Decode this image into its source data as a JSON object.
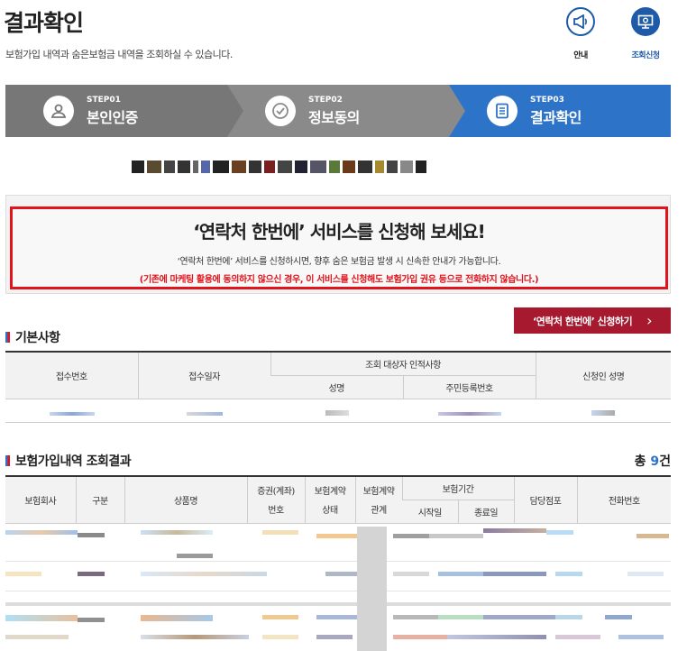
{
  "header": {
    "title": "결과확인",
    "description": "보험가입 내역과 숨은보험금 내역을 조회하실 수 있습니다.",
    "info_label": "안내",
    "apply_label": "조회신청"
  },
  "steps": [
    {
      "num": "STEP01",
      "name": "본인인증"
    },
    {
      "num": "STEP02",
      "name": "정보동의"
    },
    {
      "num": "STEP03",
      "name": "결과확인"
    }
  ],
  "banner": {
    "title": "‘연락처 한번에’ 서비스를 신청해 보세요!",
    "subtitle": "‘연락처 한번에’ 서비스를 신청하시면, 향후 숨은 보험금 발생 시 신속한 안내가 가능합니다.",
    "warning": "(기존에 마케팅 활용에 동의하지 않으신 경우, 이 서비스를 신청해도 보험가입 권유 등으로 전화하지 않습니다.)"
  },
  "apply_button": {
    "label": "‘연락처 한번에’ 신청하기",
    "arrow": "›"
  },
  "basic_section": {
    "title": "기본사항",
    "headers": {
      "receipt_no": "접수번호",
      "receipt_date": "접수일자",
      "target_group": "조회 대상자 인적사항",
      "name": "성명",
      "resident_no": "주민등록번호",
      "applicant": "신청인 성명"
    }
  },
  "result_section": {
    "title": "보험가입내역 조회결과",
    "total_prefix": "총 ",
    "total_count": "9",
    "total_suffix": "건",
    "headers": {
      "company": "보험회사",
      "category": "구분",
      "product": "상품명",
      "policy_no_1": "증권(계좌)",
      "policy_no_2": "번호",
      "contract_state_1": "보험계약",
      "contract_state_2": "상태",
      "contract_rel_1": "보험계약",
      "contract_rel_2": "관계",
      "period": "보험기간",
      "start": "시작일",
      "end": "종료일",
      "branch": "담당점포",
      "phone": "전화번호"
    }
  },
  "colors": {
    "accent": "#2d73c8",
    "brand_red": "#a6192e",
    "alert_red": "#e2131b"
  }
}
